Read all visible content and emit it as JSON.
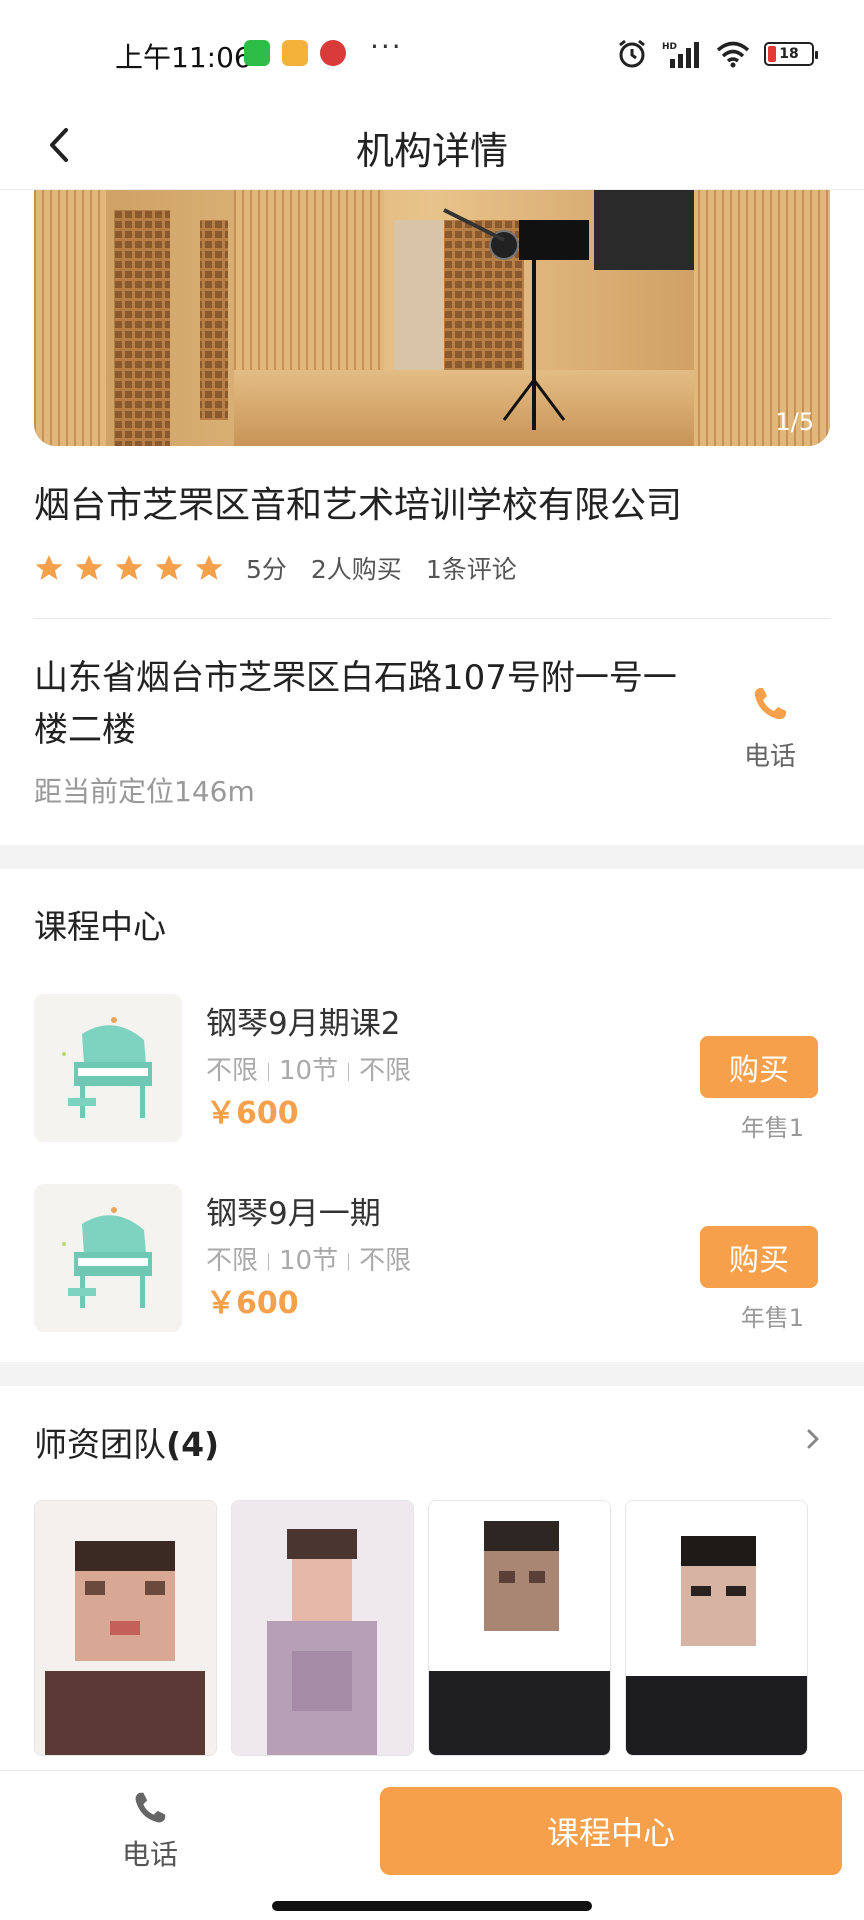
{
  "status_bar": {
    "time": "上午11:06",
    "more": "···",
    "battery": "18",
    "battery_level": 0.18,
    "icons": [
      "wechat-icon",
      "message-app-icon",
      "bank-app-icon",
      "alarm-icon",
      "hd-signal-icon",
      "wifi-icon",
      "battery-icon"
    ]
  },
  "nav": {
    "title": "机构详情",
    "back_icon": "chevron-left-icon"
  },
  "banner": {
    "counter": "1/5",
    "image": "recording-studio-photo"
  },
  "org": {
    "name": "烟台市芝罘区音和艺术培训学校有限公司",
    "rating_stars": 5,
    "score": "5分",
    "buyers": "2人购买",
    "reviews": "1条评论",
    "address": "山东省烟台市芝罘区白石路107号附一号一楼二楼",
    "distance": "距当前定位146m",
    "phone_label": "电话"
  },
  "courses_section": {
    "title": "课程中心",
    "courses": [
      {
        "name": "钢琴9月期课2",
        "meta": [
          "不限",
          "10节",
          "不限"
        ],
        "price": "￥600",
        "buy_label": "购买",
        "sold": "年售1"
      },
      {
        "name": "钢琴9月一期",
        "meta": [
          "不限",
          "10节",
          "不限"
        ],
        "price": "￥600",
        "buy_label": "购买",
        "sold": "年售1"
      }
    ]
  },
  "teachers_section": {
    "title": "师资团队",
    "count": "(4)",
    "teachers": [
      "teacher-photo-1",
      "teacher-photo-2",
      "teacher-photo-3",
      "teacher-photo-4"
    ]
  },
  "bottom_bar": {
    "phone_label": "电话",
    "course_button": "课程中心"
  },
  "colors": {
    "accent": "#f7a04b",
    "price": "#f5a04a",
    "star": "#f7a04b",
    "battery_low": "#e53935"
  }
}
